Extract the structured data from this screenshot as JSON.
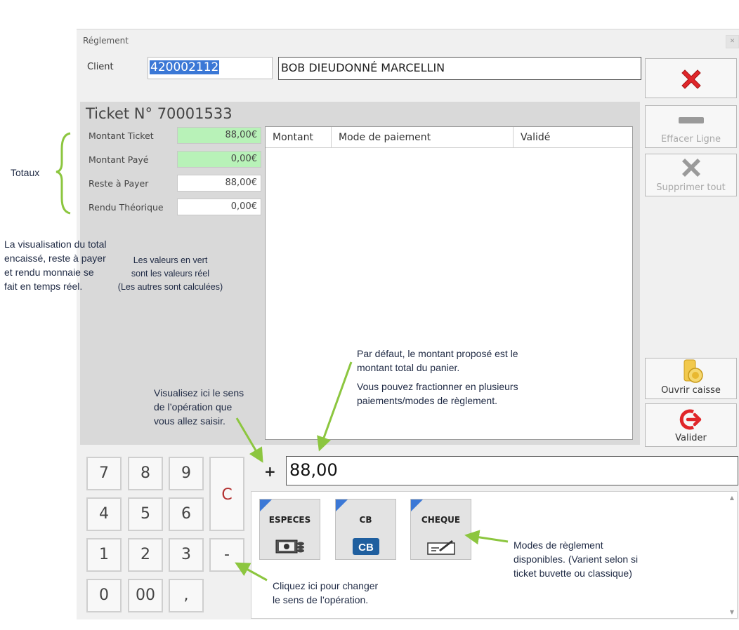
{
  "window": {
    "title": "Réglement"
  },
  "client": {
    "label": "Client",
    "code": "420002112",
    "name": "BOB DIEUDONNÉ MARCELLIN"
  },
  "ticket": {
    "title": "Ticket N° 70001533",
    "totals": [
      {
        "label": "Montant Ticket",
        "value": "88,00€",
        "real": true
      },
      {
        "label": "Montant Payé",
        "value": "0,00€",
        "real": true
      },
      {
        "label": "Reste à Payer",
        "value": "88,00€",
        "real": false
      },
      {
        "label": "Rendu Théorique",
        "value": "0,00€",
        "real": false
      }
    ],
    "columns": [
      "Montant",
      "Mode de paiement",
      "Validé"
    ]
  },
  "side_buttons": {
    "cancel": {
      "icon": "red-x-icon"
    },
    "erase_line": {
      "label": "Effacer Ligne",
      "icon": "minus-icon"
    },
    "delete_all": {
      "label": "Supprimer tout",
      "icon": "gray-x-icon"
    },
    "open_drawer": {
      "label": "Ouvrir caisse",
      "icon": "coins-icon"
    },
    "validate": {
      "label": "Valider",
      "icon": "exit-arrow-icon"
    }
  },
  "keypad": {
    "keys": [
      "7",
      "8",
      "9",
      "4",
      "5",
      "6",
      "1",
      "2",
      "3",
      "0",
      "00",
      ","
    ],
    "clear": "C",
    "sign_toggle": "-"
  },
  "entry": {
    "sign": "+",
    "amount": "88,00"
  },
  "payment_modes": [
    {
      "label": "ESPECES",
      "icon": "cash-icon"
    },
    {
      "label": "CB",
      "icon": "cb-card-icon"
    },
    {
      "label": "CHEQUE",
      "icon": "cheque-icon"
    }
  ],
  "annotations": {
    "totaux": "Totaux",
    "realtime": [
      "La visualisation du total",
      "encaissé, reste à payer",
      "et rendu monnaie se",
      "fait en temps réel."
    ],
    "green_values": [
      "Les valeurs en vert",
      "sont les valeurs réel",
      "(Les autres sont calculées)"
    ],
    "default_amount": [
      "Par défaut, le montant proposé est le",
      "montant total du panier."
    ],
    "split": [
      "Vous pouvez fractionner en plusieurs",
      "paiements/modes de règlement."
    ],
    "sign_view": [
      "Visualisez ici le sens",
      "de l’opération que",
      "vous allez saisir."
    ],
    "sign_change": [
      "Cliquez ici pour changer",
      "le sens de l’opération."
    ],
    "modes": [
      "Modes de règlement",
      "disponibles. (Varient selon si",
      "ticket buvette ou classique)"
    ]
  },
  "colors": {
    "real_value_bg": "#b8f2b8",
    "annotation_arrow": "#8cc63f",
    "mode_corner": "#3b78d6",
    "danger": "#e0262a"
  }
}
